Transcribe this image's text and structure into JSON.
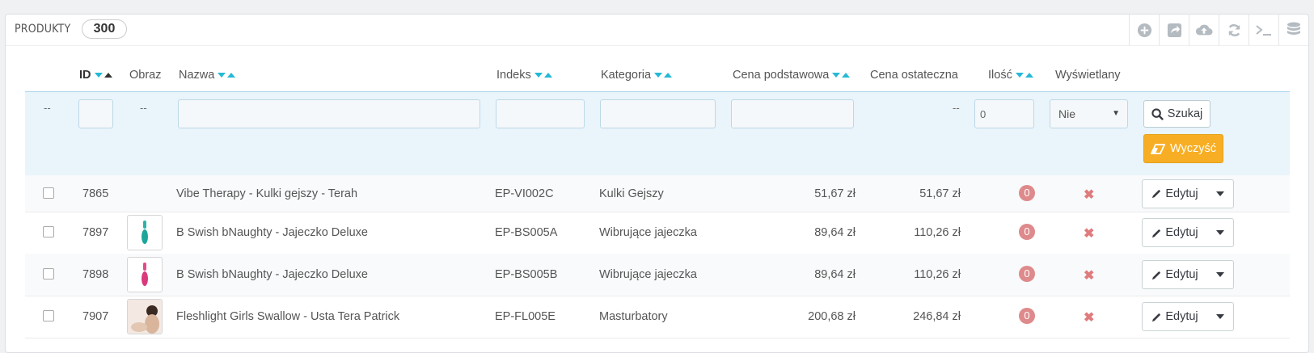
{
  "panel": {
    "title": "PRODUKTY",
    "count": "300"
  },
  "toolbar": [
    "add-icon",
    "export-icon",
    "upload-icon",
    "refresh-icon",
    "terminal-icon",
    "database-icon"
  ],
  "headers": {
    "id": "ID",
    "image": "Obraz",
    "name": "Nazwa",
    "index": "Indeks",
    "category": "Kategoria",
    "base_price": "Cena podstawowa",
    "final_price": "Cena ostateczna",
    "qty": "Ilość",
    "displayed": "Wyświetlany"
  },
  "filters": {
    "dash": "--",
    "qty_value": "0",
    "displayed_value": "Nie",
    "search_label": "Szukaj",
    "clear_label": "Wyczyść"
  },
  "rows": [
    {
      "id": "7865",
      "name": "Vibe Therapy - Kulki gejszy - Terah",
      "index": "EP-VI002C",
      "category": "Kulki Gejszy",
      "base_price": "51,67 zł",
      "final_price": "51,67 zł",
      "qty": "0",
      "thumb": "none"
    },
    {
      "id": "7897",
      "name": "B Swish bNaughty - Jajeczko Deluxe",
      "index": "EP-BS005A",
      "category": "Wibrujące jajeczka",
      "base_price": "89,64 zł",
      "final_price": "110,26 zł",
      "qty": "0",
      "thumb": "teal"
    },
    {
      "id": "7898",
      "name": "B Swish bNaughty - Jajeczko Deluxe",
      "index": "EP-BS005B",
      "category": "Wibrujące jajeczka",
      "base_price": "89,64 zł",
      "final_price": "110,26 zł",
      "qty": "0",
      "thumb": "pink"
    },
    {
      "id": "7907",
      "name": "Fleshlight Girls Swallow - Usta Tera Patrick",
      "index": "EP-FL005E",
      "category": "Masturbatory",
      "base_price": "200,68 zł",
      "final_price": "246,84 zł",
      "qty": "0",
      "thumb": "photo"
    }
  ],
  "edit_label": "Edytuj"
}
